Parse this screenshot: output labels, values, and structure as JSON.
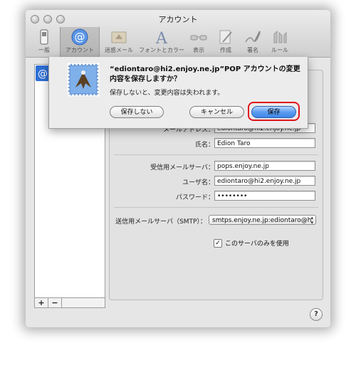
{
  "window": {
    "title": "アカウント"
  },
  "toolbar": {
    "items": [
      {
        "label": "一般",
        "icon": "switch-icon"
      },
      {
        "label": "アカウント",
        "icon": "at-sign-icon",
        "selected": true
      },
      {
        "label": "迷惑メール",
        "icon": "junk-mail-bird-icon"
      },
      {
        "label": "フォントとカラー",
        "icon": "font-icon"
      },
      {
        "label": "表示",
        "icon": "glasses-icon"
      },
      {
        "label": "作成",
        "icon": "compose-pencil-icon"
      },
      {
        "label": "署名",
        "icon": "signature-pen-icon"
      },
      {
        "label": "ルール",
        "icon": "rules-icon"
      }
    ]
  },
  "accounts": {
    "add_label": "+",
    "remove_label": "−"
  },
  "form": {
    "email_label": "メールアドレス：",
    "email_value": "ediontaro@hi2.enjoy.ne.jp",
    "name_label": "氏名：",
    "name_value": "Edion Taro",
    "incoming_label": "受信用メールサーバ：",
    "incoming_value": "pops.enjoy.ne.jp",
    "username_label": "ユーザ名：",
    "username_value": "ediontaro@hi2.enjoy.ne.jp",
    "password_label": "パスワード：",
    "password_value": "••••••••",
    "smtp_label": "送信用メールサーバ（SMTP）：",
    "smtp_value": "smtps.enjoy.ne.jp:ediontaro@h",
    "only_this_server_label": "このサーバのみを使用",
    "only_this_server_checked": true
  },
  "help_label": "?",
  "sheet": {
    "title": "“ediontaro@hi2.enjoy.ne.jp”POP アカウントの変更内容を保存しますか？",
    "message": "保存しないと、変更内容は失われます。",
    "dont_save_label": "保存しない",
    "cancel_label": "キャンセル",
    "save_label": "保存",
    "highlight_color": "#e0121b"
  }
}
